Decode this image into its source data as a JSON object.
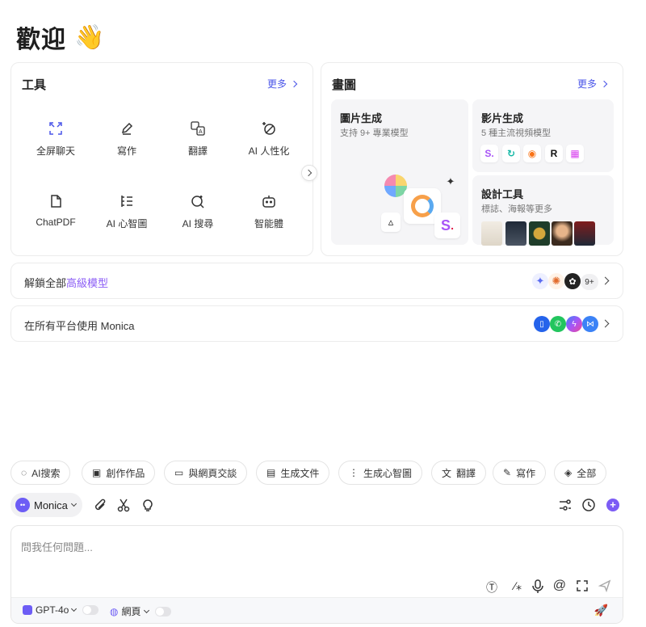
{
  "header": {
    "welcome": "歡迎",
    "wave_icon": "waving-hand-icon"
  },
  "tools_card": {
    "title": "工具",
    "more": "更多",
    "items": [
      {
        "label": "全屏聊天",
        "icon": "fullscreen-icon"
      },
      {
        "label": "寫作",
        "icon": "pen-icon"
      },
      {
        "label": "翻譯",
        "icon": "translate-icon"
      },
      {
        "label": "AI 人性化",
        "icon": "wand-icon"
      },
      {
        "label": "ChatPDF",
        "icon": "pdf-icon"
      },
      {
        "label": "AI 心智圖",
        "icon": "mindmap-icon"
      },
      {
        "label": "AI 搜尋",
        "icon": "search-sparkle-icon"
      },
      {
        "label": "智能體",
        "icon": "bot-icon"
      }
    ]
  },
  "drawing_card": {
    "title": "畫圖",
    "more": "更多",
    "image_gen": {
      "title": "圖片生成",
      "desc": "支持 9+ 專業模型"
    },
    "video_gen": {
      "title": "影片生成",
      "desc": "5 種主流視頻模型"
    },
    "design_tools": {
      "title": "設計工具",
      "desc": "標誌、海報等更多"
    }
  },
  "rows": {
    "unlock": {
      "prefix": "解鎖全部",
      "accent": "高級模型",
      "badge": "9+"
    },
    "platforms": {
      "text": "在所有平台使用 Monica"
    }
  },
  "chips": [
    "AI搜索",
    "創作作品",
    "與網頁交談",
    "生成文件",
    "生成心智圖",
    "翻譯",
    "寫作",
    "全部"
  ],
  "toolbar": {
    "model": "Monica"
  },
  "composer": {
    "placeholder": "問我任何問題...",
    "model": "GPT-4o",
    "web": "網頁"
  },
  "colors": {
    "accent": "#4a55e8",
    "purple": "#8b5cf6"
  }
}
